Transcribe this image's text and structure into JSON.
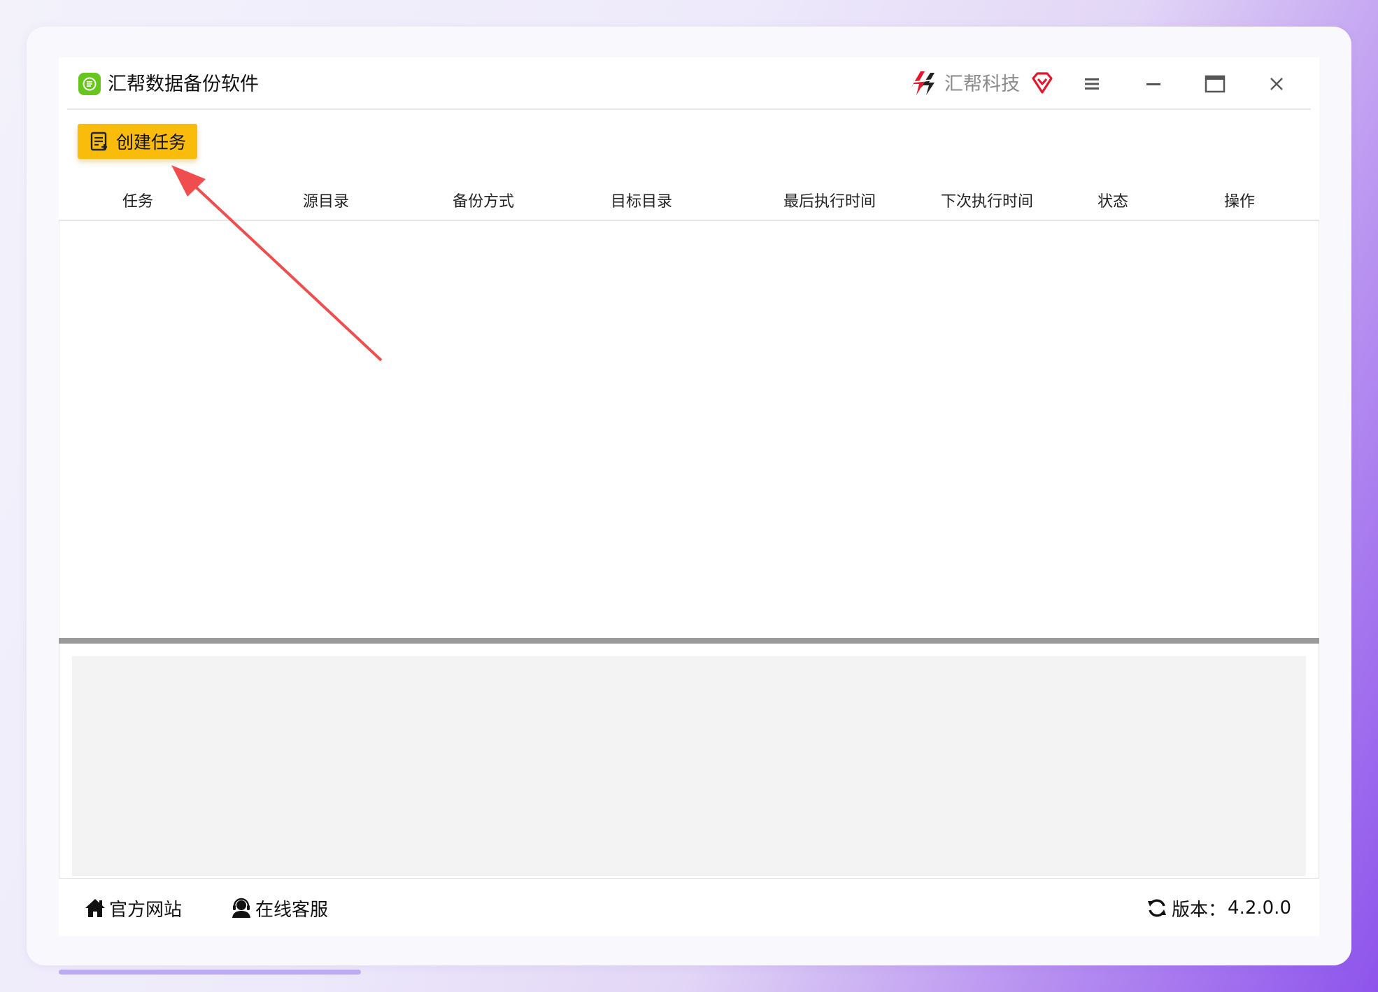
{
  "app": {
    "title": "汇帮数据备份软件",
    "brand": "汇帮科技"
  },
  "toolbar": {
    "create_label": "创建任务"
  },
  "table": {
    "columns": [
      "任务",
      "源目录",
      "备份方式",
      "目标目录",
      "最后执行时间",
      "下次执行时间",
      "状态",
      "操作"
    ],
    "rows": []
  },
  "footer": {
    "website_label": "官方网站",
    "support_label": "在线客服",
    "version_label": "版本：",
    "version_value": "4.2.0.0"
  },
  "colors": {
    "accent": "#f9bc0a",
    "app_icon": "#66c61c",
    "annotation_arrow": "#f04e4e",
    "vip_icon": "#e8152a"
  },
  "icons": {
    "app": "app-logo-icon",
    "brand": "brand-logo-icon",
    "vip": "vip-diamond-icon",
    "menu": "hamburger-menu-icon",
    "minimize": "minimize-icon",
    "maximize": "maximize-icon",
    "close": "close-icon",
    "create": "task-list-icon",
    "website": "home-icon",
    "support": "headset-user-icon",
    "refresh": "refresh-icon"
  }
}
